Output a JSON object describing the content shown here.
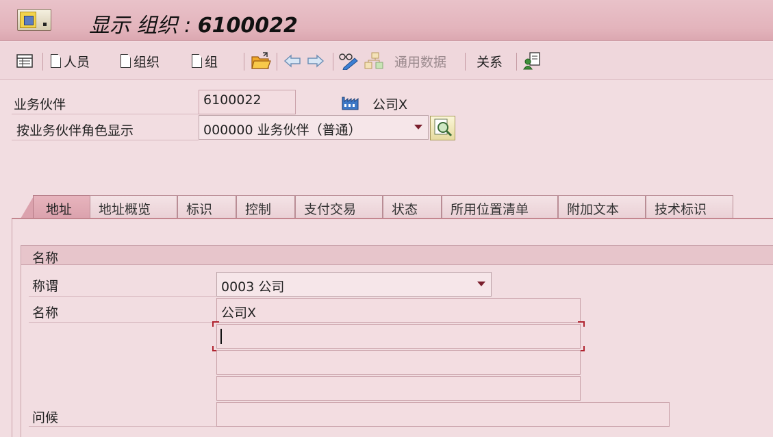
{
  "window": {
    "title_prefix": "显示 组织 : ",
    "title_number": "6100022"
  },
  "toolbar": {
    "person_label": "人员",
    "org_label": "组织",
    "group_label": "组",
    "general_data_label": "通用数据",
    "relations_label": "关系"
  },
  "header": {
    "bp_label": "业务伙伴",
    "bp_value": "6100022",
    "bp_name": "公司X",
    "role_label": "按业务伙伴角色显示",
    "role_value": "000000 业务伙伴（普通）"
  },
  "tabs": [
    {
      "label": "地址",
      "active": true
    },
    {
      "label": "地址概览"
    },
    {
      "label": "标识"
    },
    {
      "label": "控制"
    },
    {
      "label": "支付交易"
    },
    {
      "label": "状态"
    },
    {
      "label": "所用位置清单"
    },
    {
      "label": "附加文本"
    },
    {
      "label": "技术标识"
    }
  ],
  "name_group": {
    "title": "名称",
    "title_label": "称谓",
    "title_value": "0003 公司",
    "name_label": "名称",
    "name1_value": "公司X",
    "name2_value": "",
    "name3_value": "",
    "name4_value": "",
    "greeting_label": "问候",
    "greeting_value": ""
  },
  "colors": {
    "background": "#f2dde1",
    "titlebar": "#e3b4bc",
    "active_tab": "#dba2ad",
    "focus_marker": "#b0232f"
  }
}
